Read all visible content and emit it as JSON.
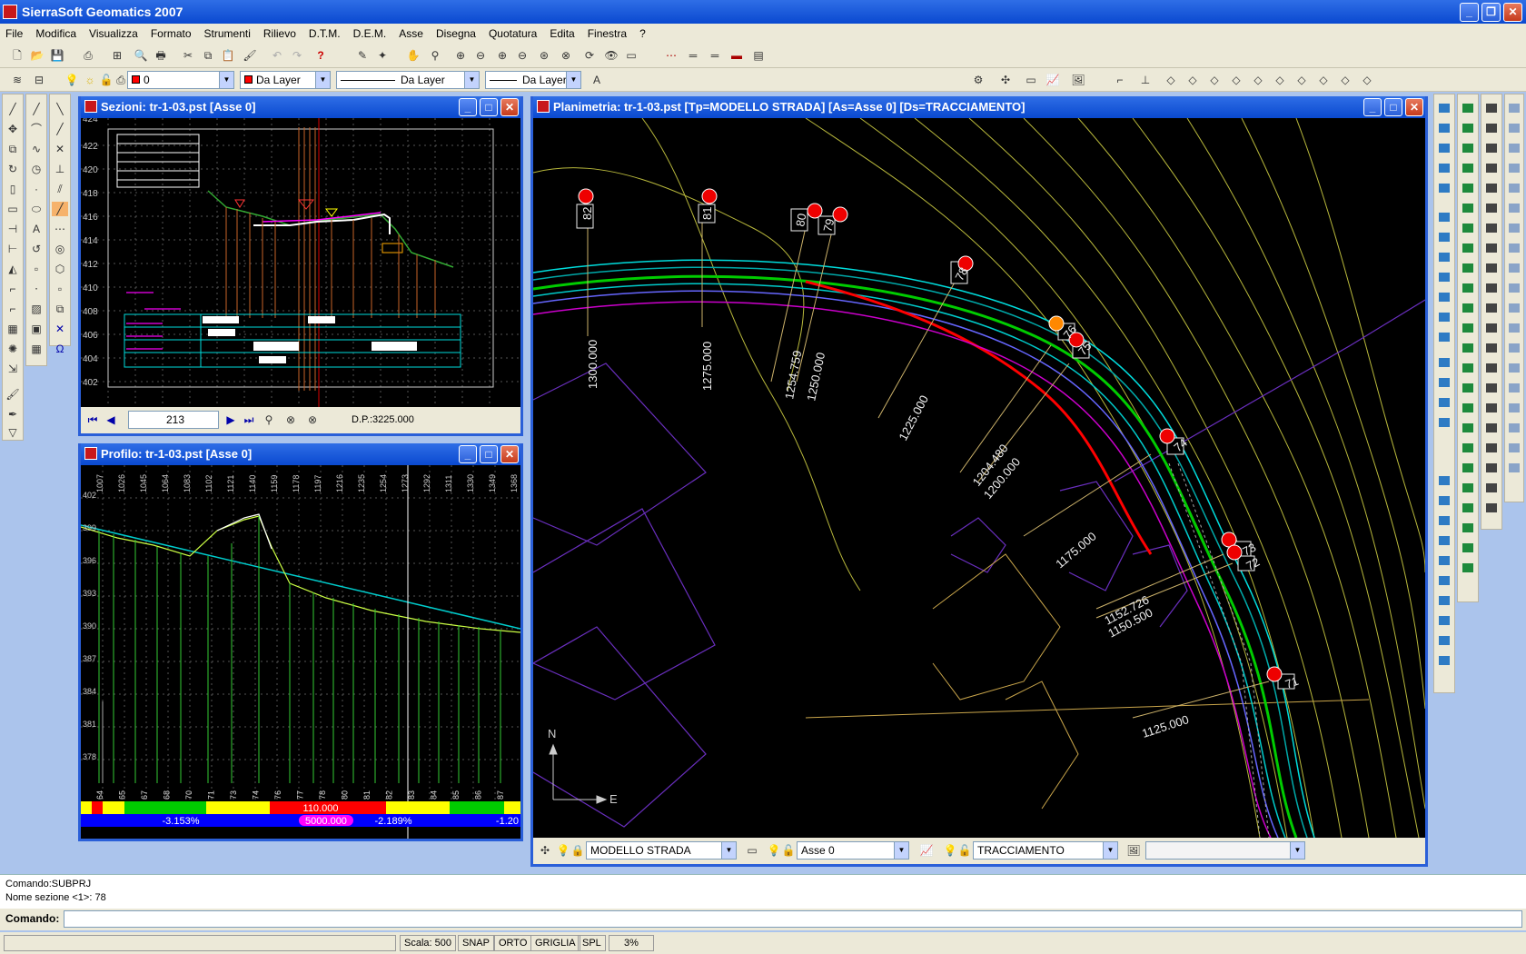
{
  "app": {
    "title": "SierraSoft  Geomatics 2007"
  },
  "menu": [
    "File",
    "Modifica",
    "Visualizza",
    "Formato",
    "Strumenti",
    "Rilievo",
    "D.T.M.",
    "D.E.M.",
    "Asse",
    "Disegna",
    "Quotatura",
    "Edita",
    "Finestra",
    "?"
  ],
  "toolbar2": {
    "layer": "0",
    "color": "Da Layer",
    "linetype": "Da Layer",
    "lineweight": "Da Layer"
  },
  "sezioni": {
    "title": "Sezioni: tr-1-03.pst [Asse 0]",
    "section": "213",
    "dp": "D.P.:3225.000",
    "yticks": [
      "424",
      "422",
      "420",
      "418",
      "416",
      "414",
      "412",
      "410",
      "408",
      "406",
      "404",
      "402"
    ]
  },
  "profilo": {
    "title": "Profilo: tr-1-03.pst [Asse 0]",
    "yticks": [
      "402",
      "399",
      "396",
      "393",
      "390",
      "387",
      "384",
      "381",
      "378"
    ],
    "xticks": [
      "1007",
      "1026",
      "1045",
      "1064",
      "1083",
      "1102",
      "1121",
      "1140",
      "1159",
      "1178",
      "1197",
      "1216",
      "1235",
      "1254",
      "1273",
      "1292",
      "1311",
      "1330",
      "1349",
      "1368"
    ],
    "stations": [
      "64",
      "65",
      "67",
      "68",
      "70",
      "71",
      "73",
      "74",
      "76",
      "77",
      "78",
      "80",
      "81",
      "82",
      "83",
      "84",
      "85",
      "86",
      "87"
    ],
    "curve_label": "110.000",
    "radius_label": "5000.000",
    "grades": [
      "-3.153%",
      "-2.189%",
      "-1.20"
    ]
  },
  "planimetria": {
    "title": "Planimetria: tr-1-03.pst [Tp=MODELLO STRADA] [As=Asse 0] [Ds=TRACCIAMENTO]",
    "chainages": [
      "1300.000",
      "1275.000",
      "1254.759",
      "1250.000",
      "1225.000",
      "1204.480",
      "1200.000",
      "1175.000",
      "1152.726",
      "1150.500",
      "1125.000"
    ],
    "sections": [
      "82",
      "81",
      "80",
      "79",
      "78",
      "76",
      "75",
      "74",
      "73",
      "72",
      "71"
    ],
    "north": "N",
    "east": "E",
    "combo_model": "MODELLO STRADA",
    "combo_axis": "Asse 0",
    "combo_layout": "TRACCIAMENTO"
  },
  "command": {
    "history1": "Comando:SUBPRJ",
    "history2": "Nome sezione <1>: 78",
    "label": "Comando:"
  },
  "status": {
    "scale": "Scala: 500",
    "snap": "SNAP",
    "orto": "ORTO",
    "griglia": "GRIGLIA",
    "spl": "SPL",
    "pct": "3%"
  }
}
